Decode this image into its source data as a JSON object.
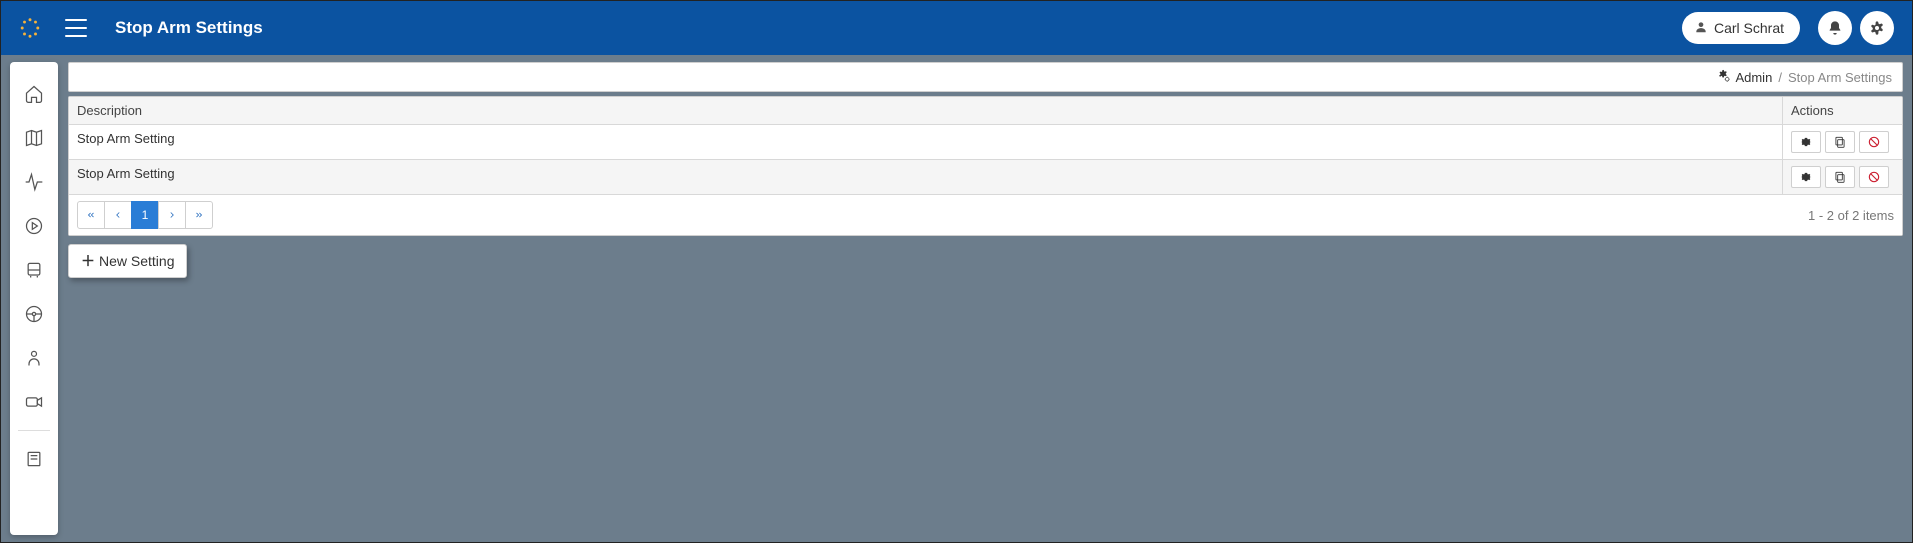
{
  "header": {
    "title": "Stop Arm Settings",
    "user_name": "Carl Schrat"
  },
  "breadcrumb": {
    "admin_label": "Admin",
    "current": "Stop Arm Settings"
  },
  "table": {
    "columns": {
      "description": "Description",
      "actions": "Actions"
    },
    "rows": [
      {
        "description": "Stop Arm Setting"
      },
      {
        "description": "Stop Arm Setting"
      }
    ]
  },
  "pagination": {
    "current_page": "1",
    "items_info": "1 - 2 of 2 items"
  },
  "buttons": {
    "new_setting": "New Setting"
  }
}
